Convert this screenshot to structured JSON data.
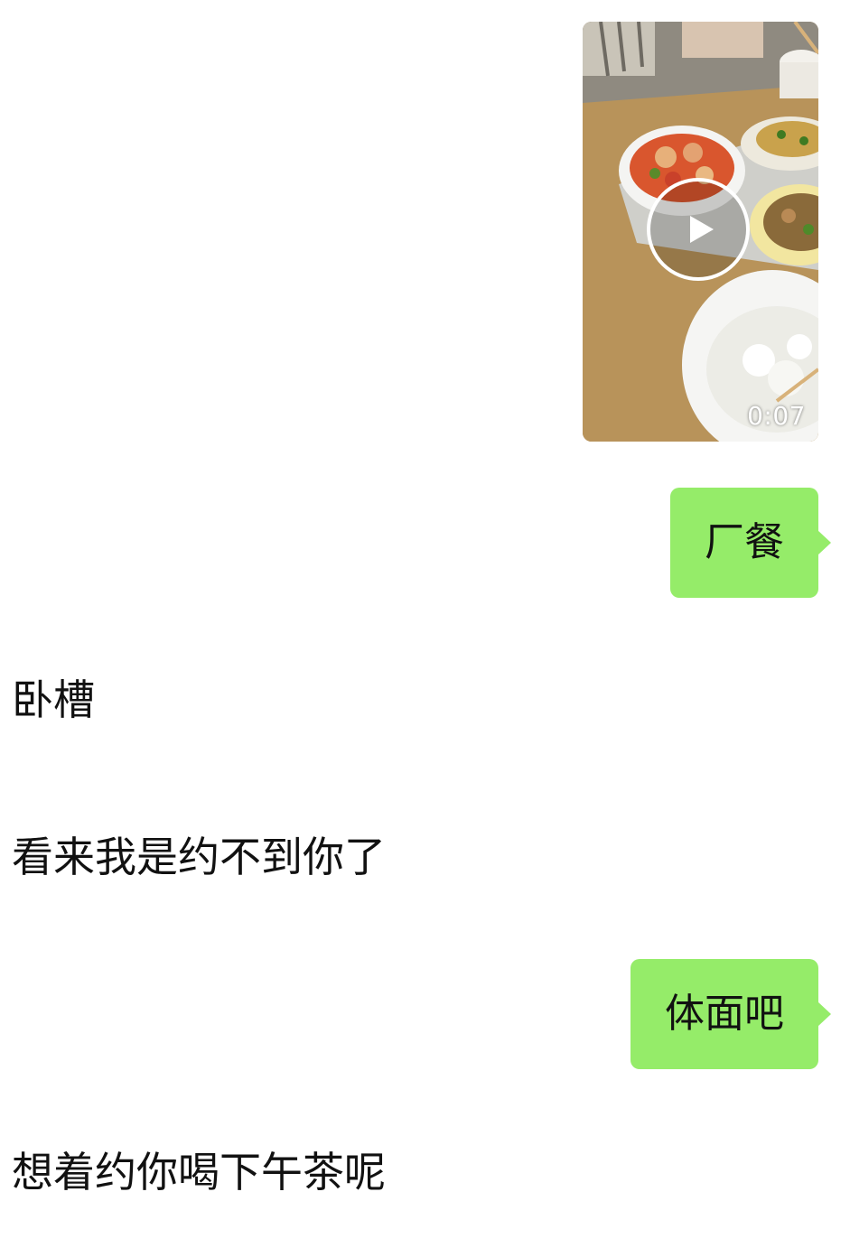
{
  "messages": {
    "video": {
      "duration": "0:07",
      "icon": "play-icon"
    },
    "outgoing": [
      {
        "text": "厂餐"
      },
      {
        "text": "体面吧"
      }
    ],
    "incoming": [
      {
        "text": "卧槽"
      },
      {
        "text": "看来我是约不到你了"
      },
      {
        "text": "想着约你喝下午茶呢"
      }
    ]
  },
  "colors": {
    "bubble_outgoing": "#95ec69",
    "background": "#ffffff",
    "text": "#111111"
  }
}
